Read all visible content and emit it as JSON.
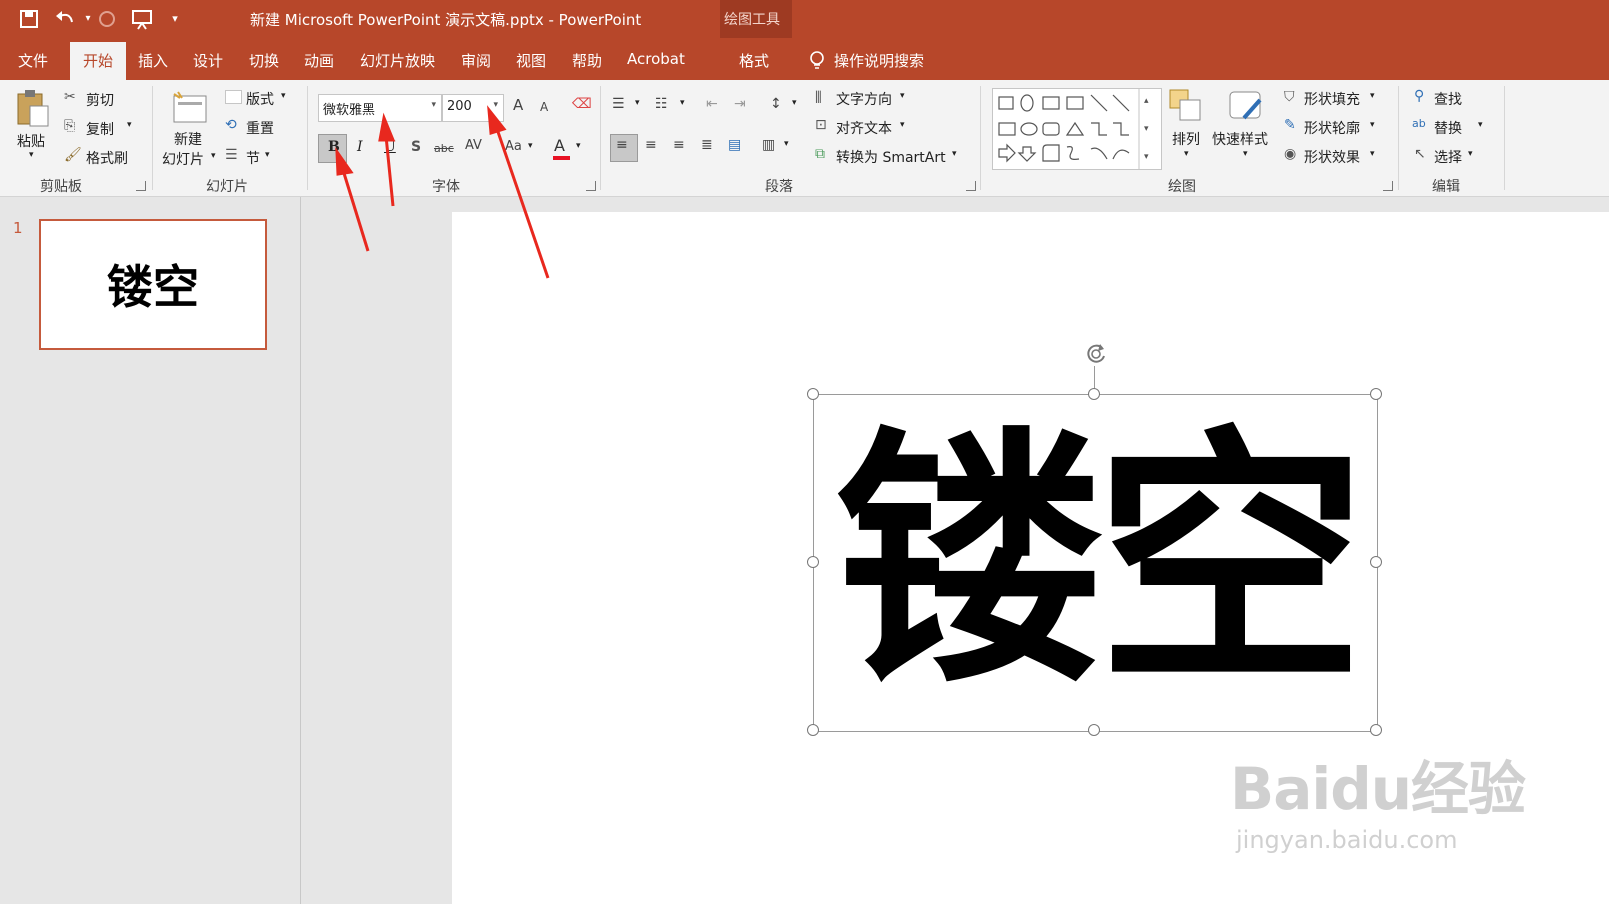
{
  "window": {
    "title": "新建 Microsoft PowerPoint 演示文稿.pptx  -  PowerPoint",
    "context_tab_group": "绘图工具"
  },
  "qat": {
    "save_icon": "save-icon",
    "undo_icon": "undo-icon",
    "redo_icon": "redo-icon",
    "present_icon": "present-icon",
    "customize_icon": "dropdown-icon"
  },
  "tabs": [
    {
      "label": "文件"
    },
    {
      "label": "开始"
    },
    {
      "label": "插入"
    },
    {
      "label": "设计"
    },
    {
      "label": "切换"
    },
    {
      "label": "动画"
    },
    {
      "label": "幻灯片放映"
    },
    {
      "label": "审阅"
    },
    {
      "label": "视图"
    },
    {
      "label": "帮助"
    },
    {
      "label": "Acrobat"
    },
    {
      "label": "格式"
    }
  ],
  "tell_me": "操作说明搜索",
  "clipboard": {
    "paste": "粘贴",
    "cut": "剪切",
    "copy": "复制",
    "format_painter": "格式刷",
    "label": "剪贴板"
  },
  "slides": {
    "new_slide_1": "新建",
    "new_slide_2": "幻灯片",
    "layout": "版式",
    "reset": "重置",
    "section": "节",
    "label": "幻灯片"
  },
  "font": {
    "name": "微软雅黑",
    "size": "200",
    "bold": "B",
    "italic": "I",
    "underline": "U",
    "shadow": "S",
    "strike": "abc",
    "spacing": "AV",
    "case": "Aa",
    "color_letter": "A",
    "grow": "A",
    "shrink": "A",
    "label": "字体",
    "color": "#e81123"
  },
  "paragraph": {
    "text_direction": "文字方向",
    "align_text": "对齐文本",
    "smartart": "转换为 SmartArt",
    "label": "段落"
  },
  "drawing": {
    "arrange": "排列",
    "quick_styles": "快速样式",
    "shape_fill": "形状填充",
    "shape_outline": "形状轮廓",
    "shape_effects": "形状效果",
    "label": "绘图"
  },
  "editing": {
    "find": "查找",
    "replace": "替换",
    "select": "选择",
    "label": "编辑"
  },
  "thumbnails": [
    {
      "number": "1",
      "text": "镂空"
    }
  ],
  "slide": {
    "text": "镂空"
  },
  "colors": {
    "accent": "#b7472a",
    "annotation": "#e8281e"
  },
  "watermark": {
    "brand": "Baidu经验",
    "url": "jingyan.baidu.com"
  }
}
